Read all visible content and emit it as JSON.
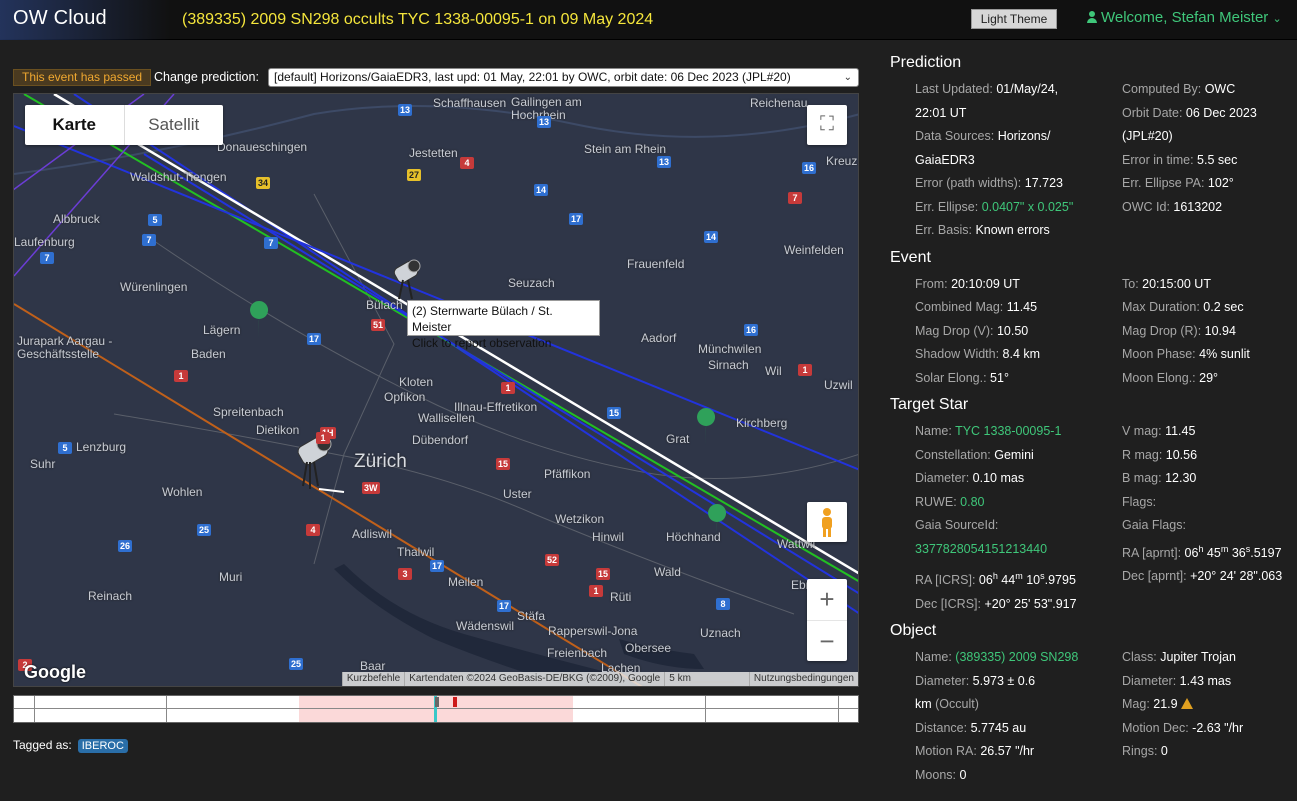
{
  "header": {
    "brand": "OW Cloud",
    "headline": "(389335) 2009 SN298 occults TYC 1338-00095-1 on 09 May 2024",
    "theme_button": "Light Theme",
    "welcome": "Welcome, Stefan Meister",
    "welcome_icon": "user-icon"
  },
  "controls": {
    "passed_badge": "This event has passed",
    "change_label": "Change prediction:",
    "prediction_selected": "[default] Horizons/GaiaEDR3, last upd: 01 May, 22:01 by OWC, orbit date: 06 Dec 2023 (JPL#20)"
  },
  "map": {
    "type_karte": "Karte",
    "type_satellit": "Satellit",
    "zoom_in": "+",
    "zoom_out": "−",
    "google": "Google",
    "tooltip_line1": "(2) Sternwarte Bülach / St. Meister",
    "tooltip_line2": "Click to report observation",
    "attribution": {
      "shortcuts": "Kurzbefehle",
      "data": "Kartendaten ©2024 GeoBasis-DE/BKG (©2009), Google",
      "scale": "5 km",
      "terms": "Nutzungsbedingungen"
    },
    "towns": [
      {
        "name": "Schaffhausen",
        "big": false
      },
      {
        "name": "Gailingen am Hochrhein",
        "big": false
      },
      {
        "name": "Reichenau",
        "big": false
      },
      {
        "name": "Donaueschingen",
        "big": false
      },
      {
        "name": "Jestetten",
        "big": false
      },
      {
        "name": "Stein am Rhein",
        "big": false
      },
      {
        "name": "Kreuz",
        "big": false
      },
      {
        "name": "Waldshut-Tiengen",
        "big": false
      },
      {
        "name": "Albbruck",
        "big": false
      },
      {
        "name": "Laufenburg",
        "big": false
      },
      {
        "name": "Frauenfeld",
        "big": false
      },
      {
        "name": "Weinfelden",
        "big": false
      },
      {
        "name": "Würenlingen",
        "big": false
      },
      {
        "name": "Seuzach",
        "big": false
      },
      {
        "name": "Bülach",
        "big": false
      },
      {
        "name": "Lägern",
        "big": false
      },
      {
        "name": "Jurapark Aargau - Geschäftsstelle",
        "big": false
      },
      {
        "name": "Baden",
        "big": false
      },
      {
        "name": "Aadorf",
        "big": false
      },
      {
        "name": "Münchwilen",
        "big": false
      },
      {
        "name": "Sirnach",
        "big": false
      },
      {
        "name": "Wil",
        "big": false
      },
      {
        "name": "Uzwil",
        "big": false
      },
      {
        "name": "Kloten",
        "big": false
      },
      {
        "name": "Opfikon",
        "big": false
      },
      {
        "name": "Wallisellen",
        "big": false
      },
      {
        "name": "Illnau-Effretikon",
        "big": false
      },
      {
        "name": "Spreitenbach",
        "big": false
      },
      {
        "name": "Dietikon",
        "big": false
      },
      {
        "name": "Dübendorf",
        "big": false
      },
      {
        "name": "Kirchberg",
        "big": false
      },
      {
        "name": "Grat",
        "big": false
      },
      {
        "name": "Lenzburg",
        "big": false
      },
      {
        "name": "Suhr",
        "big": false
      },
      {
        "name": "Zürich",
        "big": true
      },
      {
        "name": "Pfäffikon",
        "big": false
      },
      {
        "name": "Wohlen",
        "big": false
      },
      {
        "name": "Uster",
        "big": false
      },
      {
        "name": "Wetzikon",
        "big": false
      },
      {
        "name": "Adliswil",
        "big": false
      },
      {
        "name": "Hinwil",
        "big": false
      },
      {
        "name": "Höchhand",
        "big": false
      },
      {
        "name": "Wattwil",
        "big": false
      },
      {
        "name": "Thalwil",
        "big": false
      },
      {
        "name": "Muri",
        "big": false
      },
      {
        "name": "Meilen",
        "big": false
      },
      {
        "name": "Wald",
        "big": false
      },
      {
        "name": "Reinach",
        "big": false
      },
      {
        "name": "Rüti",
        "big": false
      },
      {
        "name": "Ebnat",
        "big": false
      },
      {
        "name": "Stäfa",
        "big": false
      },
      {
        "name": "Wädenswil",
        "big": false
      },
      {
        "name": "Rapperswil-Jona",
        "big": false
      },
      {
        "name": "Uznach",
        "big": false
      },
      {
        "name": "Obersee",
        "big": false
      },
      {
        "name": "Freienbach",
        "big": false
      },
      {
        "name": "Baar",
        "big": false
      },
      {
        "name": "Lachen",
        "big": false
      }
    ],
    "shields": [
      "13",
      "13",
      "4",
      "13",
      "34",
      "27",
      "14",
      "16",
      "5",
      "7",
      "17",
      "7",
      "7",
      "14",
      "7",
      "51",
      "17",
      "16",
      "1",
      "1",
      "1",
      "15",
      "1H",
      "15",
      "3W",
      "1",
      "5",
      "25",
      "4",
      "26",
      "52",
      "17",
      "3",
      "15",
      "8",
      "17",
      "2",
      "25",
      "1"
    ]
  },
  "tagged": {
    "label": "Tagged as:",
    "tag": "IBEROC"
  },
  "prediction": {
    "title": "Prediction",
    "left": [
      {
        "l": "Last Updated: ",
        "v": "01/May/24,"
      },
      {
        "l": "",
        "v": "22:01 UT"
      },
      {
        "l": "Data Sources: ",
        "v": "Horizons/"
      },
      {
        "l": "",
        "v": "GaiaEDR3"
      },
      {
        "l": "Error (path widths): ",
        "v": "17.723"
      },
      {
        "l": "Err. Ellipse: ",
        "v": "0.0407\" x 0.025\""
      },
      {
        "l": "Err. Basis: ",
        "v": "Known errors"
      }
    ],
    "right": [
      {
        "l": "Computed By: ",
        "v": "OWC"
      },
      {
        "l": "Orbit Date: ",
        "v": "06 Dec 2023"
      },
      {
        "l": "",
        "v": "(JPL#20)"
      },
      {
        "l": "Error in time: ",
        "v": "5.5 sec"
      },
      {
        "l": "Err. Ellipse PA: ",
        "v": "102°"
      },
      {
        "l": "OWC Id: ",
        "v": "1613202"
      },
      {
        "l": "",
        "v": ""
      }
    ]
  },
  "event": {
    "title": "Event",
    "left": [
      {
        "l": "From: ",
        "v": "20:10:09 UT"
      },
      {
        "l": "Combined Mag: ",
        "v": "11.45"
      },
      {
        "l": "Mag Drop (V): ",
        "v": "10.50"
      },
      {
        "l": "Shadow Width: ",
        "v": "8.4 km"
      },
      {
        "l": "Solar Elong.: ",
        "v": "51°"
      }
    ],
    "right": [
      {
        "l": "To: ",
        "v": "20:15:00 UT"
      },
      {
        "l": "Max Duration: ",
        "v": "0.2 sec"
      },
      {
        "l": "Mag Drop (R): ",
        "v": "10.94"
      },
      {
        "l": "Moon Phase: ",
        "v": "4% sunlit"
      },
      {
        "l": "Moon Elong.: ",
        "v": "29°"
      }
    ]
  },
  "target": {
    "title": "Target Star",
    "left": [
      {
        "l": "Name: ",
        "v": "TYC 1338-00095-1"
      },
      {
        "l": "Constellation: ",
        "v": "Gemini"
      },
      {
        "l": "Diameter: ",
        "v": "0.10 mas"
      },
      {
        "l": "RUWE: ",
        "v": "0.80"
      },
      {
        "l": "Gaia SourceId:",
        "v": ""
      },
      {
        "l": "",
        "v": "3377828054151213440"
      },
      {
        "l": "RA [ICRS]: ",
        "v": "06h 44m 10s.9795"
      },
      {
        "l": "Dec [ICRS]: ",
        "v": "+20° 25' 53\".917"
      }
    ],
    "right": [
      {
        "l": "V mag: ",
        "v": "11.45"
      },
      {
        "l": "R mag: ",
        "v": "10.56"
      },
      {
        "l": "B mag: ",
        "v": "12.30"
      },
      {
        "l": "Flags:",
        "v": ""
      },
      {
        "l": "Gaia Flags:",
        "v": ""
      },
      {
        "l": "RA [aprnt]: ",
        "v": "06h 45m 36s.5197"
      },
      {
        "l": "Dec [aprnt]: ",
        "v": "+20° 24' 28\".063"
      },
      {
        "l": "",
        "v": ""
      }
    ]
  },
  "object": {
    "title": "Object",
    "left": [
      {
        "l": "Name: ",
        "v": "(389335) 2009 SN298"
      },
      {
        "l": "Diameter: ",
        "v": "5.973 ± 0.6"
      },
      {
        "l": "",
        "v": "km (Occult)"
      },
      {
        "l": "Distance: ",
        "v": "5.7745 au"
      },
      {
        "l": "Motion RA: ",
        "v": "26.57 \"/hr"
      },
      {
        "l": "Moons: ",
        "v": "0"
      }
    ],
    "right": [
      {
        "l": "Class: ",
        "v": "Jupiter Trojan"
      },
      {
        "l": "Diameter: ",
        "v": "1.43 mas"
      },
      {
        "l": "Mag: ",
        "v": "21.9"
      },
      {
        "l": "Motion Dec: ",
        "v": "-2.63 \"/hr"
      },
      {
        "l": "Rings: ",
        "v": "0"
      },
      {
        "l": "",
        "v": ""
      }
    ]
  },
  "colors": {
    "accent_green": "#3fc77a",
    "headline_yellow": "#f5e63c",
    "passed_orange": "#f0a830",
    "path_center": "#ffffff",
    "path_limit": "#22c022",
    "path_sigma": "#2233dd",
    "path_other": "#c0601a"
  }
}
